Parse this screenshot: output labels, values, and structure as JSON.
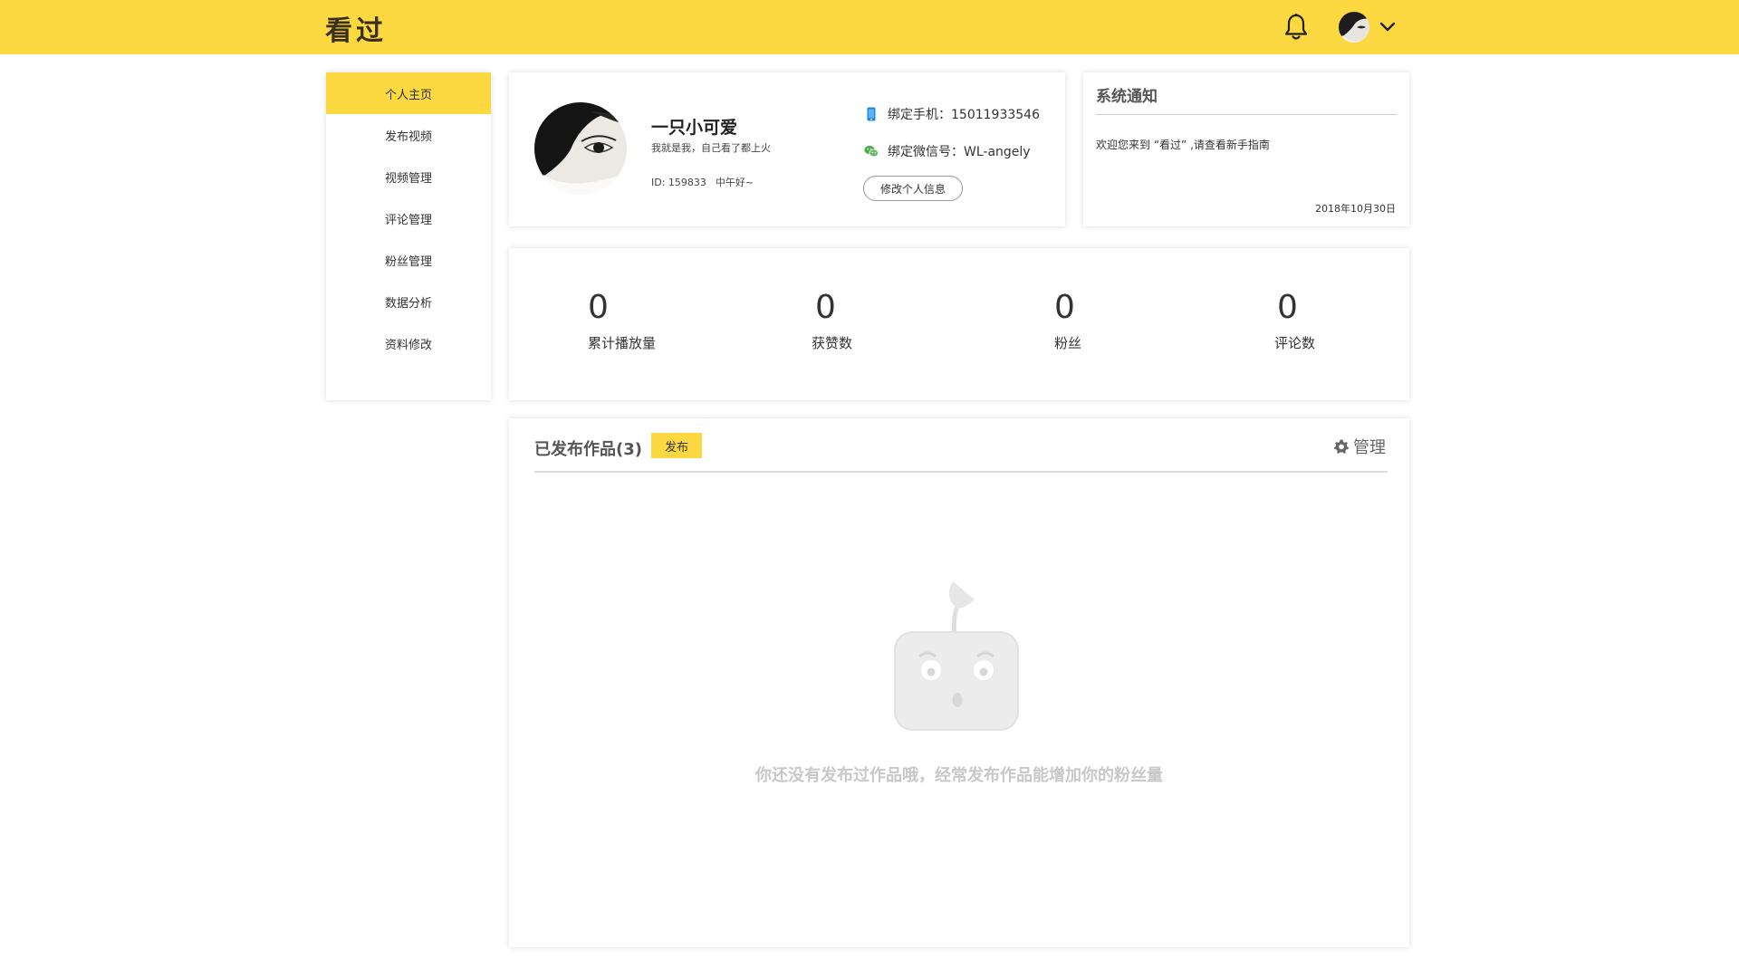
{
  "header": {
    "logo": "看过",
    "bell_icon": "bell-icon",
    "avatar_icon": "avatar",
    "chevron_icon": "chevron-down-icon",
    "accent": "#fdd941"
  },
  "sidebar": {
    "items": [
      {
        "label": "个人主页",
        "active": true
      },
      {
        "label": "发布视频",
        "active": false
      },
      {
        "label": "视频管理",
        "active": false
      },
      {
        "label": "评论管理",
        "active": false
      },
      {
        "label": "粉丝管理",
        "active": false
      },
      {
        "label": "数据分析",
        "active": false
      },
      {
        "label": "资料修改",
        "active": false
      }
    ]
  },
  "profile": {
    "nickname": "一只小可爱",
    "signature": "我就是我，自己看了都上火",
    "id": "ID: 159833",
    "greeting": "中午好~",
    "phone": "绑定手机：15011933546",
    "wechat": "绑定微信号：WL-angely",
    "edit_button": "修改个人信息",
    "phone_icon": "phone-icon",
    "wechat_icon": "wechat-icon"
  },
  "notice": {
    "title": "系统通知",
    "text": "欢迎您来到 “看过” ,请查看新手指南",
    "date": "2018年10月30日"
  },
  "stats": [
    {
      "value": "0",
      "label": "累计播放量"
    },
    {
      "value": "0",
      "label": "获赞数"
    },
    {
      "value": "0",
      "label": "粉丝"
    },
    {
      "value": "0",
      "label": "评论数"
    }
  ],
  "works": {
    "title": "已发布作品(3)",
    "publish_button": "发布",
    "manage_label": "管理",
    "manage_icon": "gear-icon",
    "empty_icon": "empty-sprout-mascot-icon",
    "empty_text": "你还没有发布过作品哦，经常发布作品能增加你的粉丝量"
  }
}
